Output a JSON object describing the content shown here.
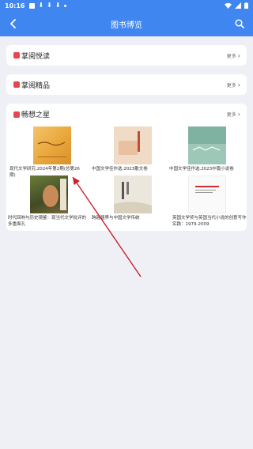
{
  "status": {
    "time": "10:16"
  },
  "appbar": {
    "title": "图书博览"
  },
  "sections": [
    {
      "title": "掌阅悦读",
      "more": "更多"
    },
    {
      "title": "掌阅精品",
      "more": "更多"
    },
    {
      "title": "畅想之星",
      "more": "更多"
    }
  ],
  "books": [
    {
      "title": "现代文学研究.2024年第2期(总第26期)"
    },
    {
      "title": "中国文学佳作选.2023散文卷"
    },
    {
      "title": "中国文学佳作选.2023中篇小说卷"
    },
    {
      "title": "时代回响与历史镜鉴：现当代文学批评的多重面孔"
    },
    {
      "title": "跨越疆界与中国文学传统"
    },
    {
      "title": "英国文学奖与英国当代小说的创意写作实践：1979-2009"
    }
  ],
  "colors": {
    "primary": "#3f86f0",
    "marker": "#e6464e",
    "arrow": "#d0202a"
  }
}
